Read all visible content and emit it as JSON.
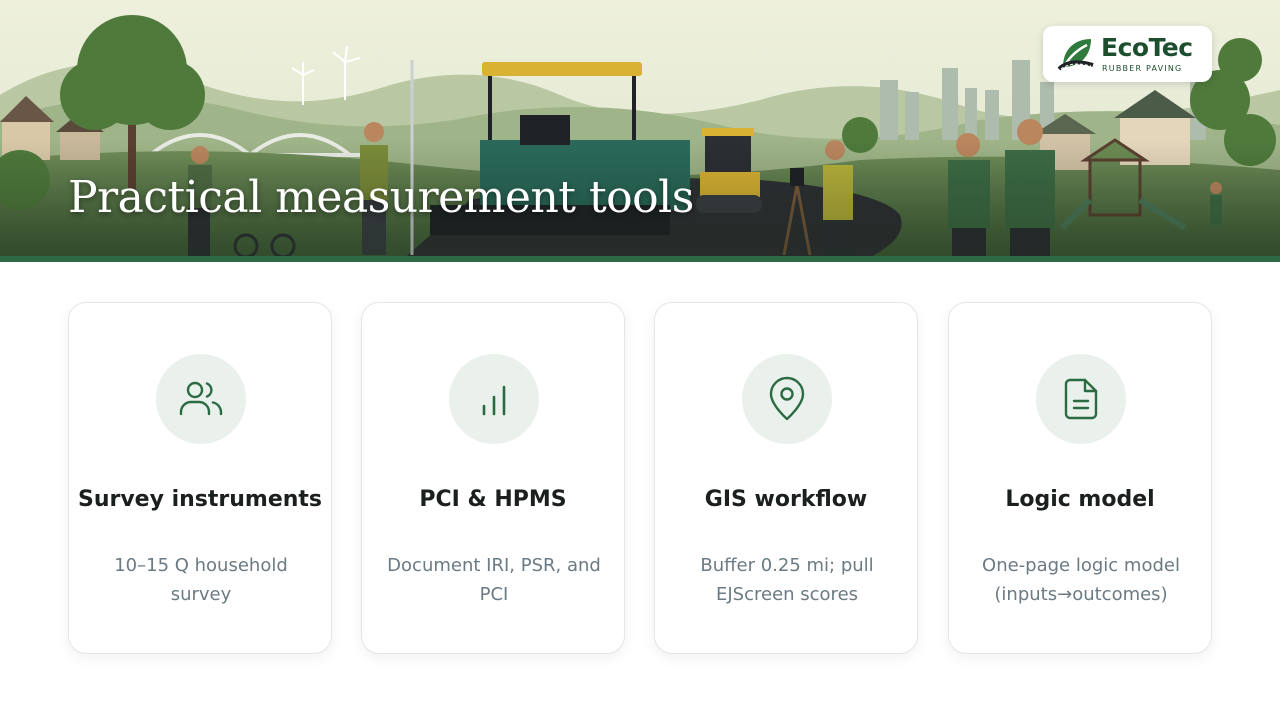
{
  "header": {
    "title": "Practical measurement tools"
  },
  "logo": {
    "name": "EcoTec",
    "subtitle": "RUBBER PAVING",
    "color": "#1d4f2e"
  },
  "cards": [
    {
      "title": "Survey instruments",
      "description": "10–15 Q household survey",
      "icon": "users-icon"
    },
    {
      "title": "PCI & HPMS",
      "description": "Document IRI, PSR, and PCI",
      "icon": "bar-chart-icon"
    },
    {
      "title": "GIS workflow",
      "description": "Buffer 0.25 mi; pull EJScreen scores",
      "icon": "map-pin-icon"
    },
    {
      "title": "Logic model",
      "description": "One-page logic model (inputs→outcomes)",
      "icon": "document-icon"
    }
  ],
  "colors": {
    "accent": "#2f6a45",
    "icon_bg": "#eaf0ec",
    "card_title": "#1b1f1d",
    "card_text": "#6b7a83"
  }
}
